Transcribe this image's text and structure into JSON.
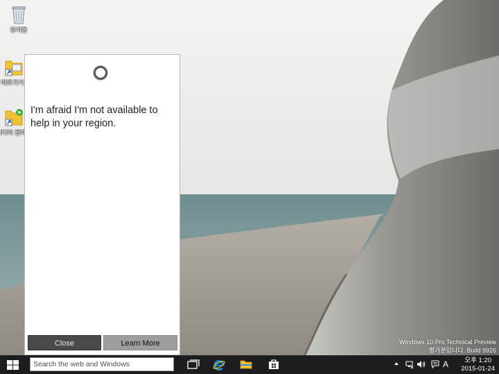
{
  "desktop": {
    "icons": [
      {
        "label": "휴지통",
        "icon": "recycle-bin-icon"
      },
      {
        "label": "바로가기",
        "icon": "folder-shortcut-icon"
      },
      {
        "label": "미디어 플레이어",
        "icon": "media-folder-shortcut-icon"
      }
    ]
  },
  "cortana": {
    "message": "I'm afraid I'm not available to help in your region.",
    "close_label": "Close",
    "learn_more_label": "Learn More"
  },
  "watermark": {
    "line1": "Windows 10 Pro Technical Preview",
    "line2": "평가본입니다. Build 9926"
  },
  "taskbar": {
    "search_placeholder": "Search the web and Windows",
    "pinned": [
      {
        "name": "task-view",
        "icon": "task-view-icon"
      },
      {
        "name": "internet-explorer",
        "icon": "internet-explorer-icon"
      },
      {
        "name": "file-explorer",
        "icon": "folder-icon"
      },
      {
        "name": "store",
        "icon": "store-icon"
      }
    ],
    "tray": {
      "ime_indicator": "A",
      "time": "오후 1:20",
      "date": "2015-01-24"
    }
  },
  "colors": {
    "taskbar": "#1d1d1f",
    "close_button": "#4a4a4a",
    "learn_button": "#9e9e9e",
    "ie_blue": "#1e8fd8",
    "folder_yellow": "#f1c232"
  }
}
